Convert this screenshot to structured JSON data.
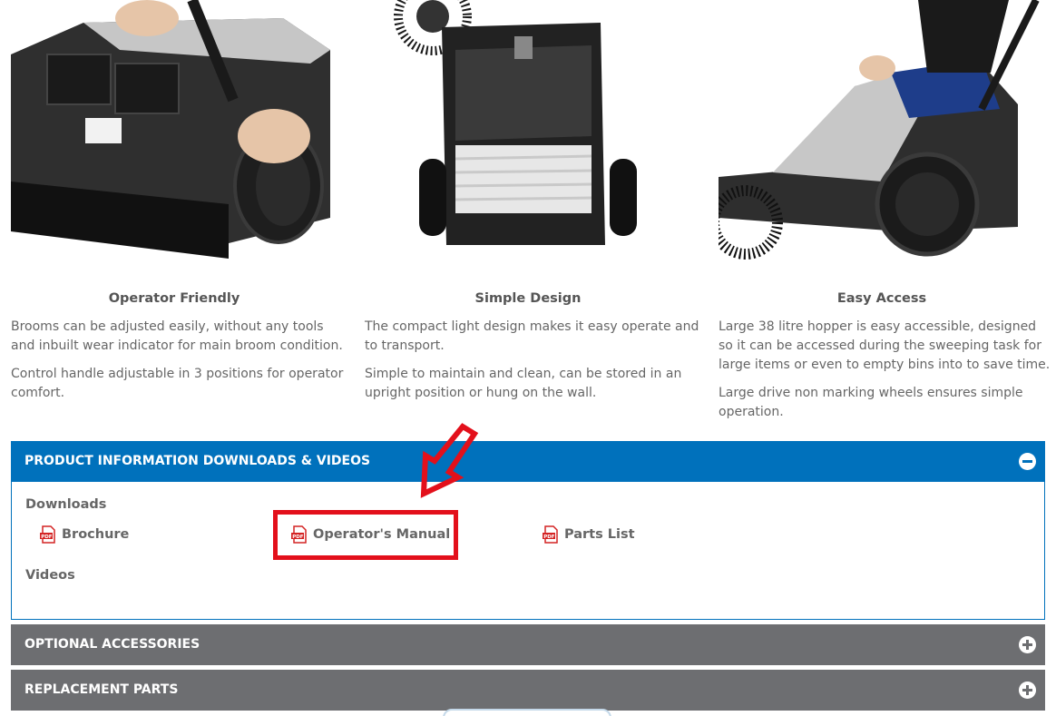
{
  "features": [
    {
      "title": "Operator Friendly",
      "paragraphs": [
        "Brooms can be adjusted easily, without any tools and inbuilt wear indicator for main broom condition.",
        "Control handle adjustable in 3 positions for operator comfort."
      ]
    },
    {
      "title": "Simple Design",
      "paragraphs": [
        "The compact light design makes it easy operate and to transport.",
        "Simple to maintain and clean, can be stored in an upright position or hung on the wall."
      ]
    },
    {
      "title": "Easy Access",
      "paragraphs": [
        "Large 38 litre hopper is easy accessible, designed so it can be accessed during the sweeping task for large items or even to empty bins into to save time.",
        "Large drive non marking wheels ensures simple operation."
      ]
    }
  ],
  "accordion": {
    "downloads_panel": {
      "title": "PRODUCT INFORMATION DOWNLOADS & VIDEOS",
      "downloads_label": "Downloads",
      "videos_label": "Videos",
      "files": [
        "Brochure",
        "Operator's Manual",
        "Parts List"
      ]
    },
    "accessories_panel": {
      "title": "OPTIONAL ACCESSORIES"
    },
    "parts_panel": {
      "title": "REPLACEMENT PARTS"
    }
  },
  "icons": {
    "pdf": "pdf-icon",
    "collapse": "minus-circle-icon",
    "expand": "plus-circle-icon"
  },
  "colors": {
    "accent_blue": "#0071bc",
    "panel_grey": "#6d6e71",
    "highlight_red": "#e3101b"
  }
}
